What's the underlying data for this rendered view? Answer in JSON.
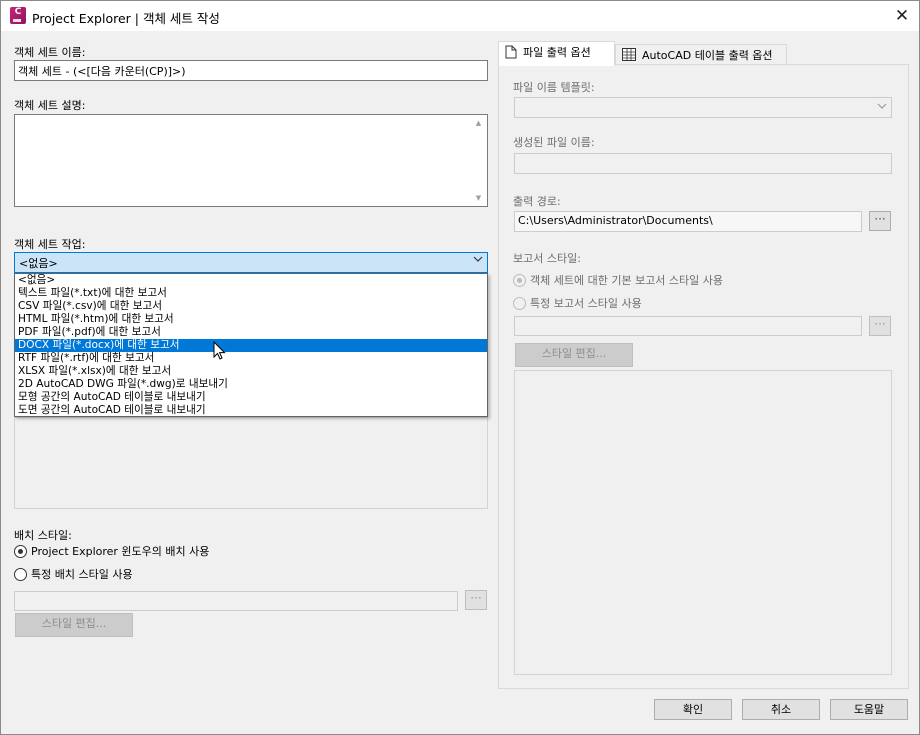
{
  "window": {
    "title": "Project Explorer | 객체 세트 작성",
    "close_glyph": "✕"
  },
  "left": {
    "name_label": "객체 세트 이름:",
    "name_value": "객체 세트 - (<[다음 카운터(CP)]>)",
    "desc_label": "객체 세트 설명:",
    "desc_value": "",
    "action_label": "객체 세트 작업:",
    "action_selected": "<없음>",
    "action_options": [
      "<없음>",
      "텍스트 파일(*.txt)에 대한 보고서",
      "CSV 파일(*.csv)에 대한 보고서",
      "HTML 파일(*.htm)에 대한 보고서",
      "PDF 파일(*.pdf)에 대한 보고서",
      "DOCX 파일(*.docx)에 대한 보고서",
      "RTF 파일(*.rtf)에 대한 보고서",
      "XLSX 파일(*.xlsx)에 대한 보고서",
      "2D AutoCAD DWG 파일(*.dwg)로 내보내기",
      "모형 공간의 AutoCAD 테이블로 내보내기",
      "도면 공간의 AutoCAD 테이블로 내보내기"
    ],
    "highlighted_index": 5,
    "layout_label": "배치 스타일:",
    "layout_radio_1": "Project Explorer 윈도우의 배치 사용",
    "layout_radio_2": "특정 배치 스타일 사용",
    "layout_selected": 1,
    "layout_style_value": "",
    "edit_style_button": "스타일 편집..."
  },
  "tabs": {
    "tab1": "파일 출력 옵션",
    "tab2": "AutoCAD 테이블 출력 옵션",
    "active": "tab1"
  },
  "file_output": {
    "template_label": "파일 이름 템플릿:",
    "template_value": "",
    "generated_label": "생성된 파일 이름:",
    "generated_value": "",
    "path_label": "출력 경로:",
    "path_value": "C:\\Users\\Administrator\\Documents\\",
    "report_style_label": "보고서 스타일:",
    "report_radio_1": "객체 세트에 대한 기본 보고서 스타일 사용",
    "report_radio_2": "특정 보고서 스타일 사용",
    "report_selected": 1,
    "report_style_value": "",
    "edit_style_button": "스타일 편집..."
  },
  "footer": {
    "ok": "확인",
    "cancel": "취소",
    "help": "도움말"
  },
  "browse_glyph": "···",
  "colors": {
    "selection": "#0078d7",
    "combo_focus_bg": "#cce4f7",
    "dialog_bg": "#f0f0f0",
    "app_icon": "#c6247a"
  }
}
